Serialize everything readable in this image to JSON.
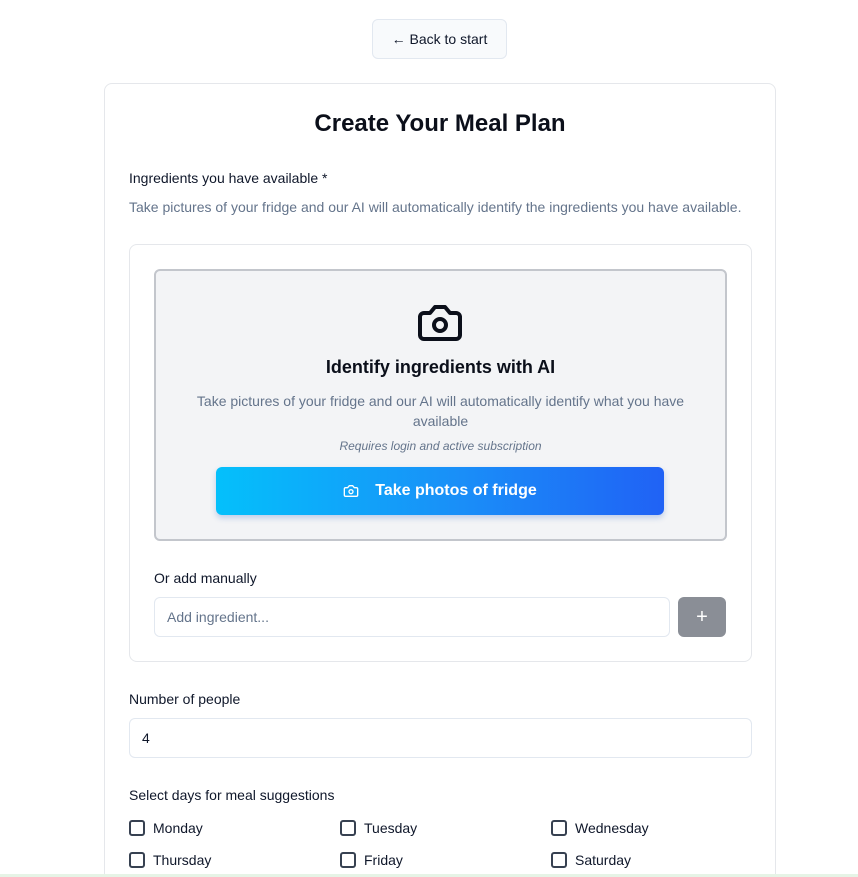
{
  "nav": {
    "back_label": "← Back to start"
  },
  "form": {
    "title": "Create Your Meal Plan",
    "ingredients": {
      "label": "Ingredients you have available *",
      "help": "Take pictures of your fridge and our AI will automatically identify the ingredients you have available.",
      "ai_panel": {
        "icon": "camera-icon",
        "title": "Identify ingredients with AI",
        "description": "Take pictures of your fridge and our AI will automatically identify what you have available",
        "note": "Requires login and active subscription",
        "button_label": "Take photos of fridge"
      },
      "manual_label": "Or add manually",
      "input_placeholder": "Add ingredient...",
      "add_button_label": "+"
    },
    "people": {
      "label": "Number of people",
      "value": "4"
    },
    "days": {
      "label": "Select days for meal suggestions",
      "items": [
        {
          "label": "Monday",
          "checked": false
        },
        {
          "label": "Tuesday",
          "checked": false
        },
        {
          "label": "Wednesday",
          "checked": false
        },
        {
          "label": "Thursday",
          "checked": false
        },
        {
          "label": "Friday",
          "checked": false
        },
        {
          "label": "Saturday",
          "checked": false
        }
      ]
    }
  },
  "colors": {
    "button_gradient_start": "#04c0fb",
    "button_gradient_end": "#2062f5",
    "add_button": "#8a8e96",
    "panel_bg": "#f3f4f6"
  }
}
